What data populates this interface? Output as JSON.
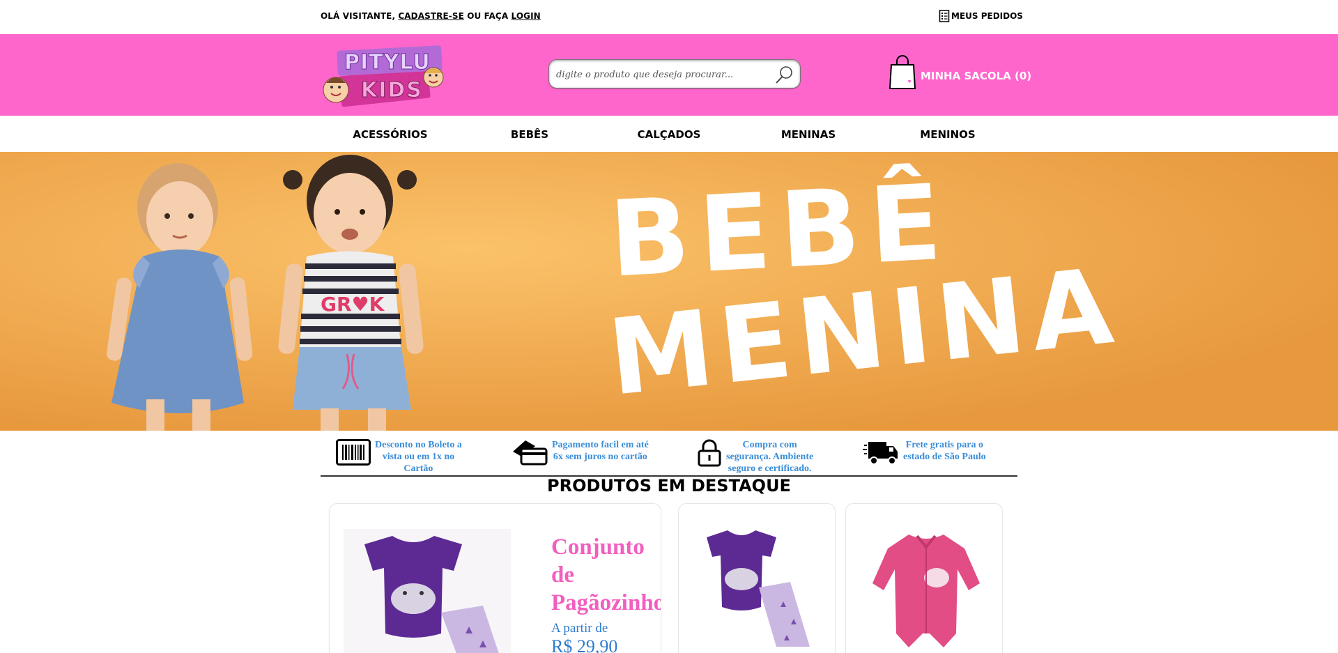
{
  "topbar": {
    "greeting": "OLÁ VISITANTE,",
    "register": "CADASTRE-SE",
    "or_do": "OU FAÇA",
    "login": "LOGIN",
    "orders": "MEUS PEDIDOS"
  },
  "header": {
    "logo_text_top": "PITYLU",
    "logo_text_bottom": "KIDS",
    "search_placeholder": "digite o produto que deseja procurar...",
    "cart_label": "MINHA SACOLA (0)"
  },
  "nav": {
    "items": [
      "ACESSÓRIOS",
      "BEBÊS",
      "CALÇADOS",
      "MENINAS",
      "MENINOS"
    ]
  },
  "banner": {
    "line1": "BEBÊ",
    "line2": "MENINA",
    "shirt_text": "GR♥K"
  },
  "benefits": [
    {
      "icon": "barcode-icon",
      "lines": [
        "Desconto no Boleto a",
        "vista ou em 1x no",
        "Cartão"
      ]
    },
    {
      "icon": "credit-card-icon",
      "lines": [
        "Pagamento facil em até",
        "6x sem juros no cartão"
      ]
    },
    {
      "icon": "lock-icon",
      "lines": [
        "Compra com",
        "segurança. Ambiente",
        "seguro e certificado."
      ]
    },
    {
      "icon": "delivery-truck-icon",
      "lines": [
        "Frete gratis para o",
        "estado de São Paulo"
      ]
    }
  ],
  "section_title": "PRODUTOS EM DESTAQUE",
  "featured": {
    "name_lines": [
      "Conjunto",
      "de",
      "Pagãozinho"
    ],
    "from_label": "A partir de",
    "price": "R$ 29,90"
  },
  "colors": {
    "header_pink": "#ff66cc",
    "benefit_blue": "#3b8ed8",
    "product_pink": "#f25fbf",
    "price_blue": "#2f7bd0",
    "banner_orange": "#f3a54b"
  }
}
